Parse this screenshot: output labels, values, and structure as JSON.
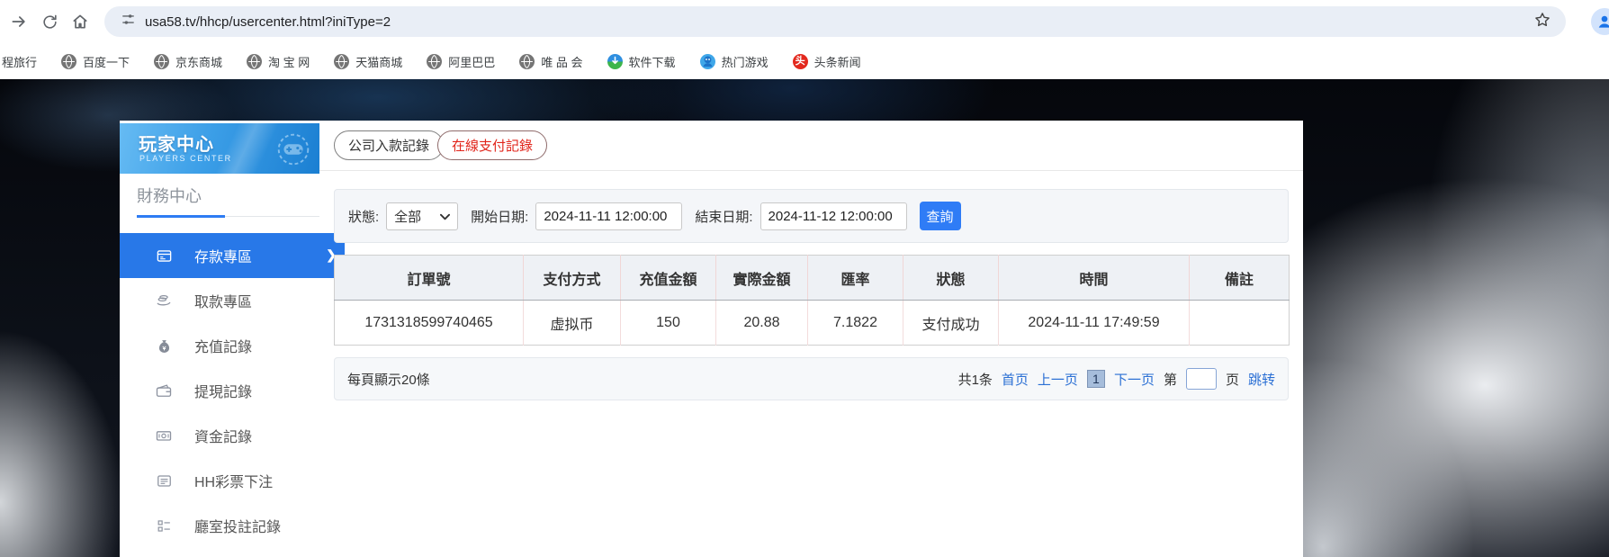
{
  "browser": {
    "url": "usa58.tv/hhcp/usercenter.html?iniType=2",
    "bookmarks": [
      {
        "label": "程旅行",
        "icon": "none"
      },
      {
        "label": "百度一下",
        "icon": "globe-icon"
      },
      {
        "label": "京东商城",
        "icon": "globe-icon"
      },
      {
        "label": "淘 宝 网",
        "icon": "globe-icon"
      },
      {
        "label": "天猫商城",
        "icon": "globe-icon"
      },
      {
        "label": "阿里巴巴",
        "icon": "globe-icon"
      },
      {
        "label": "唯 品 会",
        "icon": "globe-icon"
      },
      {
        "label": "软件下载",
        "icon": "download-icon"
      },
      {
        "label": "热门游戏",
        "icon": "game-icon"
      },
      {
        "label": "头条新闻",
        "icon": "news-icon",
        "icon_glyph": "头"
      }
    ]
  },
  "sidebar": {
    "banner_title": "玩家中心",
    "banner_subtitle": "PLAYERS CENTER",
    "section_title": "財務中心",
    "items": [
      {
        "label": "存款專區",
        "icon": "deposit-icon",
        "active": true
      },
      {
        "label": "取款專區",
        "icon": "withdraw-icon",
        "active": false
      },
      {
        "label": "充值記錄",
        "icon": "recharge-record-icon",
        "active": false
      },
      {
        "label": "提現記錄",
        "icon": "withdrawal-record-icon",
        "active": false
      },
      {
        "label": "資金記錄",
        "icon": "funds-record-icon",
        "active": false
      },
      {
        "label": "HH彩票下注",
        "icon": "lottery-bet-icon",
        "active": false
      },
      {
        "label": "廳室投註記錄",
        "icon": "hall-bet-record-icon",
        "active": false
      }
    ]
  },
  "tabs": [
    {
      "label": "公司入款記錄",
      "active": false
    },
    {
      "label": "在線支付記錄",
      "active": true
    }
  ],
  "filters": {
    "status_label": "狀態:",
    "status_value": "全部",
    "start_label": "開始日期:",
    "start_value": "2024-11-11 12:00:00",
    "end_label": "結束日期:",
    "end_value": "2024-11-12 12:00:00",
    "query_button": "查詢"
  },
  "table": {
    "headers": [
      "訂單號",
      "支付方式",
      "充值金額",
      "實際金額",
      "匯率",
      "狀態",
      "時間",
      "備註"
    ],
    "rows": [
      [
        "1731318599740465",
        "虚拟币",
        "150",
        "20.88",
        "7.1822",
        "支付成功",
        "2024-11-11 17:49:59",
        ""
      ]
    ]
  },
  "pagination": {
    "page_size_text": "每頁顯示20條",
    "total_text": "共1条",
    "first": "首页",
    "prev": "上一页",
    "current_page": "1",
    "next": "下一页",
    "jump_prefix": "第",
    "jump_value": "",
    "jump_suffix": "页",
    "jump_action": "跳转"
  },
  "colors": {
    "accent_blue": "#2f7cf6",
    "active_tab_red": "#e1251b",
    "link_blue": "#2a6fd4",
    "banner_blue_light": "#66bbf3",
    "banner_blue_dark": "#1b7fd2",
    "table_header_bg": "#eef1f5",
    "cell_divider_pink": "#f3dcdc"
  }
}
